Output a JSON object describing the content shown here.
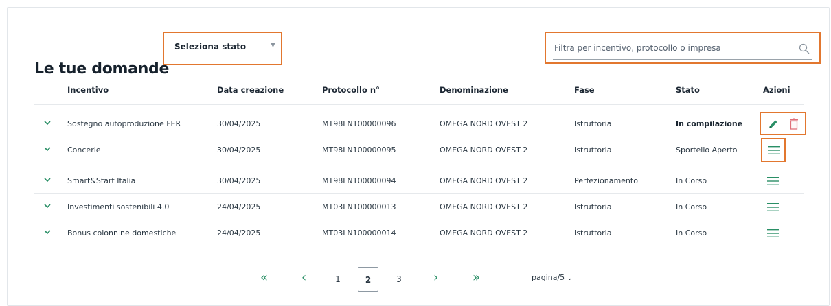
{
  "header": {
    "title": "Le tue domande",
    "status_select": {
      "selected": "Seleziona stato"
    },
    "search": {
      "placeholder": "Filtra per incentivo, protocollo o impresa"
    }
  },
  "table": {
    "columns": [
      "Incentivo",
      "Data creazione",
      "Protocollo n°",
      "Denominazione",
      "Fase",
      "Stato",
      "Azioni"
    ],
    "rows": [
      {
        "incentivo": "Sostegno autoproduzione FER",
        "data": "30/04/2025",
        "protocollo": "MT98LN100000096",
        "denominazione": "OMEGA NORD OVEST 2",
        "fase": "Istruttoria",
        "stato": "In compilazione",
        "actions": [
          "edit-icon",
          "trash-icon"
        ]
      },
      {
        "incentivo": "Concerie",
        "data": "30/04/2025",
        "protocollo": "MT98LN100000095",
        "denominazione": "OMEGA NORD OVEST 2",
        "fase": "Istruttoria",
        "stato": "Sportello Aperto",
        "actions": [
          "list-icon"
        ]
      },
      {
        "incentivo": "Smart&Start Italia",
        "data": "30/04/2025",
        "protocollo": "MT98LN100000094",
        "denominazione": "OMEGA NORD OVEST 2",
        "fase": "Perfezionamento",
        "stato": "In Corso",
        "actions": [
          "list-icon"
        ]
      },
      {
        "incentivo": "Investimenti sostenibili 4.0",
        "data": "24/04/2025",
        "protocollo": "MT03LN100000013",
        "denominazione": "OMEGA NORD OVEST 2",
        "fase": "Istruttoria",
        "stato": "In Corso",
        "actions": [
          "list-icon"
        ]
      },
      {
        "incentivo": "Bonus colonnine domestiche",
        "data": "24/04/2025",
        "protocollo": "MT03LN100000014",
        "denominazione": "OMEGA NORD OVEST 2",
        "fase": "Istruttoria",
        "stato": "In Corso",
        "actions": [
          "list-icon"
        ]
      }
    ]
  },
  "pagination": {
    "first": "«",
    "prev": "‹",
    "pages": [
      "1",
      "2",
      "3"
    ],
    "current": "2",
    "next": "›",
    "last": "»",
    "page_label": "pagina/5"
  },
  "colors": {
    "accent": "#2a8f66",
    "highlight": "#e2772f",
    "delete": "#e0707a"
  }
}
